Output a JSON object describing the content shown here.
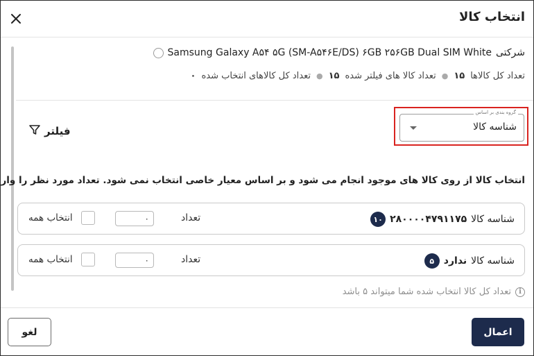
{
  "dialog": {
    "title": "انتخاب کالا",
    "close_icon": "close-icon"
  },
  "product": {
    "brand": "شرکتی",
    "name": "Samsung Galaxy A۵۴ ۵G (SM-A۵۴۶E/DS) ۶GB ۲۵۶GB Dual SIM White",
    "selected": false
  },
  "stats": {
    "total_label": "تعداد کل کالاها",
    "total_value": "۱۵",
    "filtered_label": "تعداد کالا های فیلتر شده",
    "filtered_value": "۱۵",
    "selected_label": "تعداد کل کالاهای انتخاب شده",
    "selected_value": "۰"
  },
  "group_by": {
    "legend": "گروه بندی بر اساس",
    "value": "شناسه کالا"
  },
  "filter": {
    "label": "فیلتر",
    "icon": "funnel-icon"
  },
  "note": "انتخاب کالا از روی کالا های موجود انجام می شود و بر اساس معیار خاصی انتخاب نمی شود. تعداد مورد نظر را وارد کنید.",
  "groups": [
    {
      "label": "شناسه کالا",
      "value": "۲۸۰۰۰۰۴۷۹۱۱۷۵",
      "count": "۱۰",
      "qty_label": "تعداد",
      "qty_value": "۰",
      "select_all": "انتخاب همه"
    },
    {
      "label": "شناسه کالا",
      "value": "ندارد",
      "count": "۵",
      "qty_label": "تعداد",
      "qty_value": "۰",
      "select_all": "انتخاب همه"
    }
  ],
  "info": {
    "icon": "info-icon",
    "text": "تعداد کل کالا انتخاب شده شما میتواند ۵ باشد"
  },
  "footer": {
    "apply": "اعمال",
    "cancel": "لغو"
  },
  "colors": {
    "primary": "#1d2b4c",
    "highlight": "#d9231f",
    "muted": "#8e8e8e"
  }
}
